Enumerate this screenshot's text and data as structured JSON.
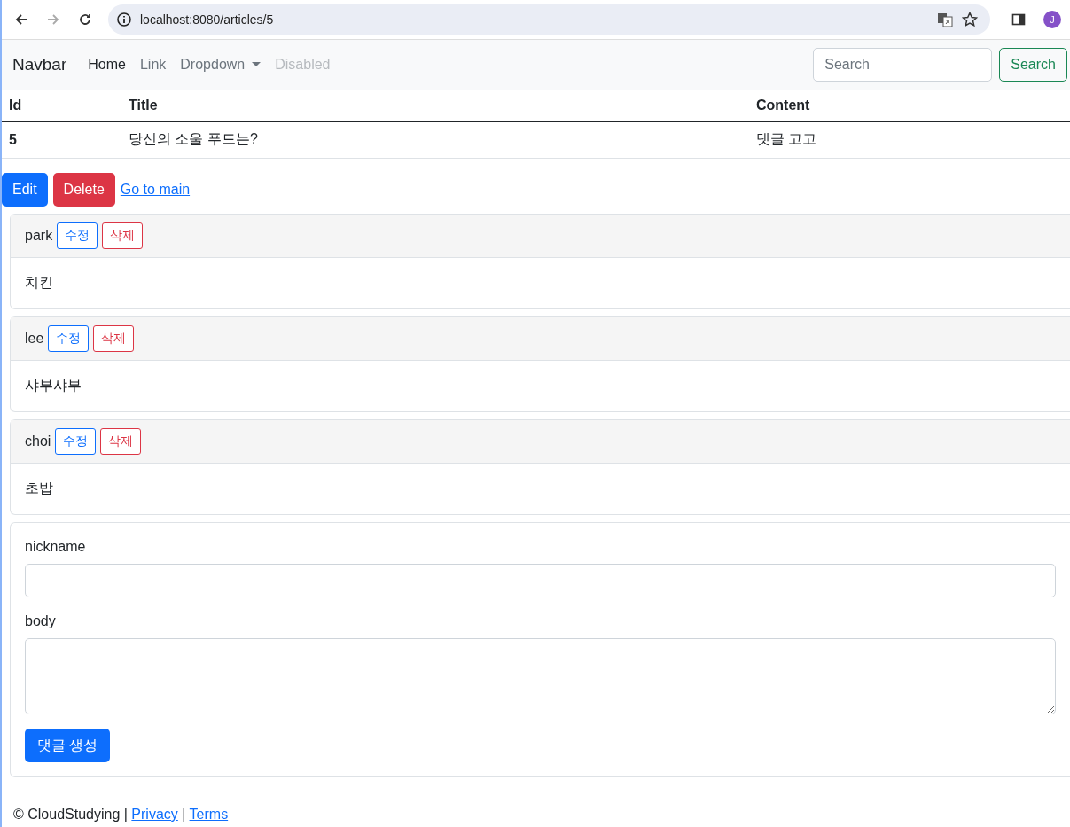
{
  "browser": {
    "url": "localhost:8080/articles/5",
    "profile_initial": "J"
  },
  "navbar": {
    "brand": "Navbar",
    "items": [
      {
        "label": "Home",
        "kind": "link",
        "selected": true,
        "disabled": false
      },
      {
        "label": "Link",
        "kind": "link",
        "selected": false,
        "disabled": false
      },
      {
        "label": "Dropdown",
        "kind": "dropdown",
        "selected": false,
        "disabled": false
      },
      {
        "label": "Disabled",
        "kind": "link",
        "selected": false,
        "disabled": true
      }
    ],
    "search": {
      "placeholder": "Search",
      "button": "Search"
    }
  },
  "table": {
    "columns": [
      "Id",
      "Title",
      "Content"
    ],
    "rows": [
      [
        "5",
        "당신의 소울 푸드는?",
        "댓글 고고"
      ]
    ]
  },
  "actions": {
    "edit": "Edit",
    "delete": "Delete",
    "link": "Go to main"
  },
  "comments": [
    {
      "nickname": "park",
      "edit": "수정",
      "delete": "삭제",
      "body": "치킨"
    },
    {
      "nickname": "lee",
      "edit": "수정",
      "delete": "삭제",
      "body": "샤부샤부"
    },
    {
      "nickname": "choi",
      "edit": "수정",
      "delete": "삭제",
      "body": "초밥"
    }
  ],
  "form": {
    "nickname_label": "nickname",
    "body_label": "body",
    "submit": "댓글 생성"
  },
  "footer": {
    "copyright": "© CloudStudying",
    "separator": "|",
    "links": [
      "Privacy",
      "Terms"
    ]
  }
}
